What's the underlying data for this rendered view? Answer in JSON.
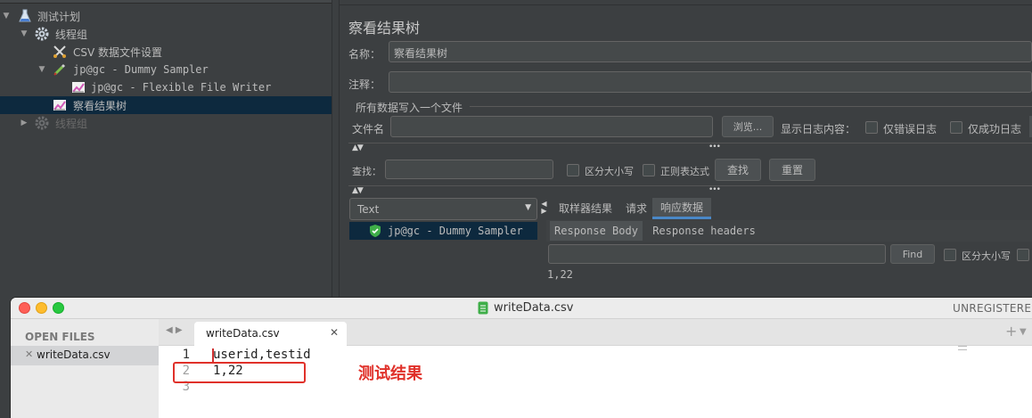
{
  "tree": {
    "items": [
      {
        "label": "测试计划"
      },
      {
        "label": "线程组"
      },
      {
        "label": "CSV 数据文件设置"
      },
      {
        "label": "jp@gc - Dummy Sampler"
      },
      {
        "label": "jp@gc - Flexible File Writer"
      },
      {
        "label": "察看结果树"
      },
      {
        "label": "线程组"
      }
    ]
  },
  "panel": {
    "title": "察看结果树",
    "name_label": "名称：",
    "name_value": "察看结果树",
    "comment_label": "注释：",
    "comment_value": "",
    "file_section_title": "所有数据写入一个文件",
    "filename_label": "文件名",
    "filename_value": "",
    "browse_label": "浏览...",
    "log_content_label": "显示日志内容：",
    "errors_only_label": "仅错误日志",
    "success_only_label": "仅成功日志",
    "search_label": "查找：",
    "search_value": "",
    "case_label": "区分大小写",
    "regex_label": "正则表达式",
    "find_label": "查找",
    "reset_label": "重置",
    "renderer_value": "Text",
    "result_sample": "jp@gc - Dummy Sampler",
    "tabs": [
      {
        "label": "取样器结果"
      },
      {
        "label": "请求"
      },
      {
        "label": "响应数据"
      }
    ],
    "subtabs": [
      {
        "label": "Response Body"
      },
      {
        "label": "Response headers"
      }
    ],
    "find_value": "",
    "find_button": "Find",
    "case_label2": "区分大小写",
    "response_body": "1,22"
  },
  "sublime": {
    "title": "writeData.csv",
    "unregistered": "UNREGISTERED",
    "open_files_label": "OPEN FILES",
    "sidebar_file": "writeData.csv",
    "tab_label": "writeData.csv",
    "lines": [
      {
        "num": "1",
        "text": "userid,testid"
      },
      {
        "num": "2",
        "text": "1,22"
      },
      {
        "num": "3",
        "text": ""
      }
    ],
    "annotation": "测试结果"
  },
  "colors": {
    "accent": "#4a88c7",
    "annotation": "#e0312a",
    "selected_row": "#0d293e",
    "success_icon": "#3fae49"
  },
  "icons": [
    "expand-arrow-icon",
    "collapse-arrow-icon",
    "flask-icon",
    "gear-icon",
    "scissors-icon",
    "pipette-icon",
    "chart-icon",
    "shield-check-icon",
    "dropdown-arrow-icon",
    "close-icon",
    "plus-icon",
    "file-icon"
  ]
}
